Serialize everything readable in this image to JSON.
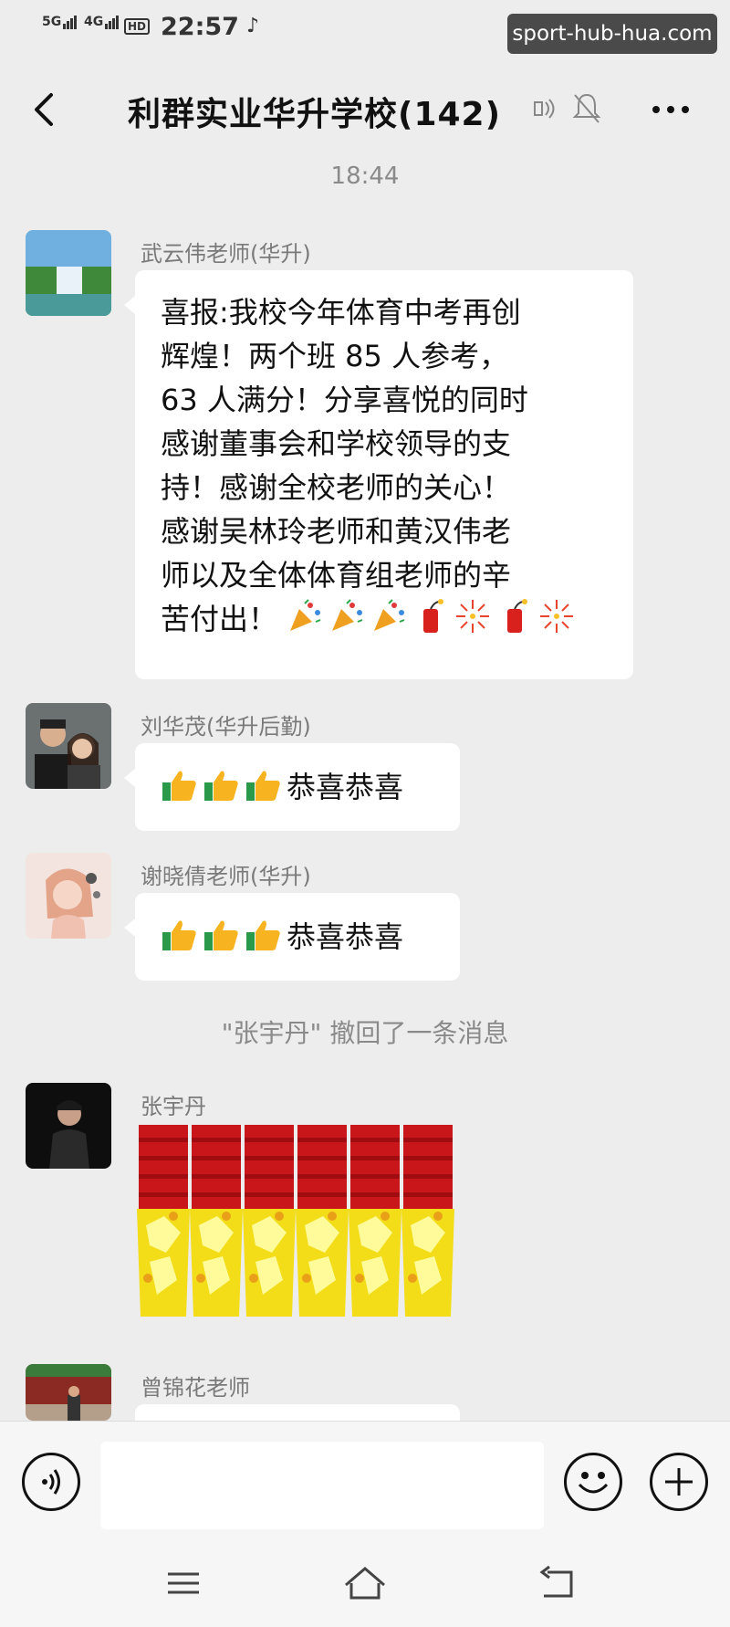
{
  "status_bar": {
    "signal_1": "5G",
    "signal_2": "4G",
    "hd": "HD",
    "time": "22:57",
    "app_icon": "tiktok-icon"
  },
  "watermark": "sport-hub-hua.com",
  "header": {
    "title": "利群实业华升学校(142)",
    "icons": [
      "back-icon",
      "voice-off-icon",
      "mute-icon",
      "more-icon"
    ]
  },
  "chat": {
    "timestamp": "18:44",
    "messages": [
      {
        "sender": "武云伟老师(华升)",
        "lines": [
          "喜报:我校今年体育中考再创",
          "辉煌！两个班 85 人参考，",
          "63 人满分！分享喜悦的同时",
          "感谢董事会和学校领导的支",
          "持！感谢全校老师的关心！",
          "感谢吴林玲老师和黄汉伟老",
          "师以及全体体育组老师的辛",
          "苦付出！"
        ],
        "emojis": [
          "party-popper-icon",
          "party-popper-icon",
          "party-popper-icon",
          "firecracker-icon",
          "fireworks-icon",
          "firecracker-icon",
          "fireworks-icon"
        ]
      },
      {
        "sender": "刘华茂(华升后勤)",
        "text": "恭喜恭喜",
        "thumbs": 3
      },
      {
        "sender": "谢晓倩老师(华升)",
        "text": "恭喜恭喜",
        "thumbs": 3
      },
      {
        "sender": "张宇丹",
        "sticker": "firecracker-sticker"
      },
      {
        "sender": "曾锦花老师"
      }
    ],
    "recall_notice": "\"张宇丹\" 撤回了一条消息"
  },
  "input_bar": {
    "value": ""
  },
  "colors": {
    "background": "#ededed",
    "bubble": "#ffffff",
    "meta_text": "#8a8a8a",
    "watermark_bg": "#4a4a4a"
  }
}
